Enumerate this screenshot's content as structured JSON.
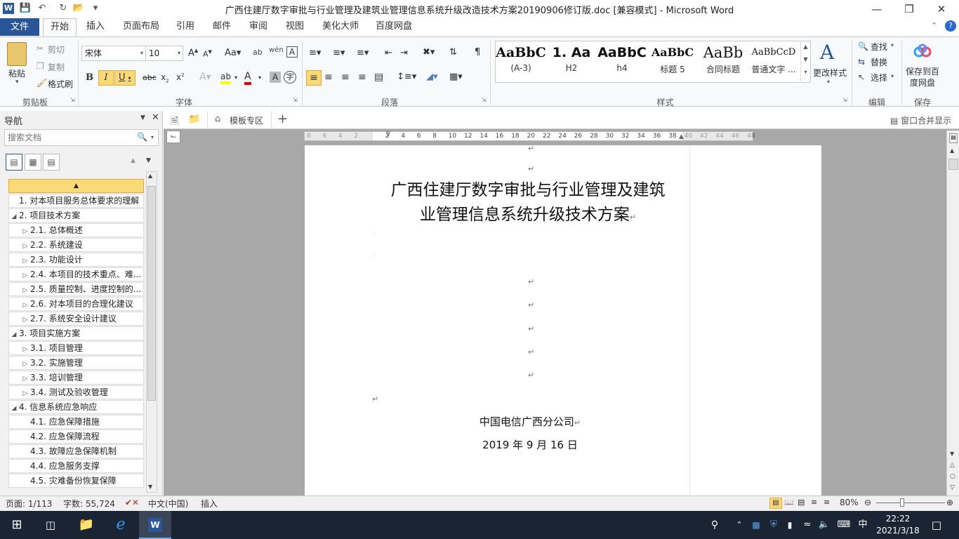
{
  "window": {
    "title": "广西住建厅数字审批与行业管理及建筑业管理信息系统升级改造技术方案20190906修订版.doc [兼容模式]  -  Microsoft Word",
    "app_icon": "W"
  },
  "ribbon_tabs": [
    "文件",
    "开始",
    "插入",
    "页面布局",
    "引用",
    "邮件",
    "审阅",
    "视图",
    "美化大师",
    "百度网盘"
  ],
  "ribbon": {
    "clipboard": {
      "paste": "粘贴",
      "cut": "剪切",
      "copy": "复制",
      "format_painter": "格式刷",
      "label": "剪贴板"
    },
    "font": {
      "name": "宋体",
      "size": "10",
      "label": "字体"
    },
    "paragraph": {
      "label": "段落"
    },
    "styles": {
      "label": "样式",
      "items": [
        {
          "preview": "AaBbC",
          "name": "(A-3)"
        },
        {
          "preview": "1.  Aa",
          "name": "H2"
        },
        {
          "preview": "AaBbC",
          "name": "h4"
        },
        {
          "preview": "AaBbC",
          "name": "标题 5"
        },
        {
          "preview": "AaBb",
          "name": "合同标题"
        },
        {
          "preview": "AaBbCcD",
          "name": "普通文字 ..."
        }
      ],
      "change_styles": "更改样式"
    },
    "editing": {
      "find": "查找",
      "replace": "替换",
      "select": "选择",
      "label": "编辑"
    },
    "save": {
      "save_to_baidu": "保存到百度网盘",
      "label": "保存"
    }
  },
  "nav": {
    "title": "导航",
    "search_placeholder": "搜索文档",
    "items": [
      {
        "level": 1,
        "text": "1. 对本项目服务总体要求的理解",
        "expander": ""
      },
      {
        "level": 1,
        "text": "2. 项目技术方案",
        "expander": "◢"
      },
      {
        "level": 2,
        "text": "2.1. 总体概述",
        "expander": "▷"
      },
      {
        "level": 2,
        "text": "2.2. 系统建设",
        "expander": "▷"
      },
      {
        "level": 2,
        "text": "2.3. 功能设计",
        "expander": "▷"
      },
      {
        "level": 2,
        "text": "2.4. 本项目的技术重点、难...",
        "expander": "▷"
      },
      {
        "level": 2,
        "text": "2.5. 质量控制、进度控制的...",
        "expander": "▷"
      },
      {
        "level": 2,
        "text": "2.6. 对本项目的合理化建议",
        "expander": "▷"
      },
      {
        "level": 2,
        "text": "2.7. 系统安全设计建议",
        "expander": "▷"
      },
      {
        "level": 1,
        "text": "3. 项目实施方案",
        "expander": "◢"
      },
      {
        "level": 2,
        "text": "3.1. 项目管理",
        "expander": "▷"
      },
      {
        "level": 2,
        "text": "3.2. 实施管理",
        "expander": "▷"
      },
      {
        "level": 2,
        "text": "3.3. 培训管理",
        "expander": "▷"
      },
      {
        "level": 2,
        "text": "3.4. 测试及验收管理",
        "expander": "▷"
      },
      {
        "level": 1,
        "text": "4. 信息系统应急响应",
        "expander": "◢"
      },
      {
        "level": 2,
        "text": "4.1. 应急保障措施",
        "expander": ""
      },
      {
        "level": 2,
        "text": "4.2. 应急保障流程",
        "expander": ""
      },
      {
        "level": 2,
        "text": "4.3. 故障应急保障机制",
        "expander": ""
      },
      {
        "level": 2,
        "text": "4.4. 应急服务支撑",
        "expander": ""
      },
      {
        "level": 2,
        "text": "4.5. 灾难备份恢复保障",
        "expander": ""
      }
    ]
  },
  "doc_tabs": {
    "template_zone": "模板专区",
    "merge_windows": "窗口合并显示"
  },
  "ruler_ticks": [
    "8",
    "6",
    "4",
    "2",
    "",
    "2",
    "4",
    "6",
    "8",
    "10",
    "12",
    "14",
    "16",
    "18",
    "20",
    "22",
    "24",
    "26",
    "28",
    "30",
    "32",
    "34",
    "36",
    "38",
    "40",
    "42",
    "44",
    "46",
    "48"
  ],
  "document": {
    "title_line1": "广西住建厅数字审批与行业管理及建筑",
    "title_line2": "业管理信息系统升级技术方案",
    "company": "中国电信广西分公司",
    "date": "2019 年 9 月 16 日",
    "para_mark": "↵"
  },
  "status": {
    "page": "页面: 1/113",
    "words": "字数: 55,724",
    "language": "中文(中国)",
    "mode": "插入",
    "zoom": "80%"
  },
  "taskbar": {
    "time": "22:22",
    "date": "2021/3/18",
    "ime": "中"
  }
}
